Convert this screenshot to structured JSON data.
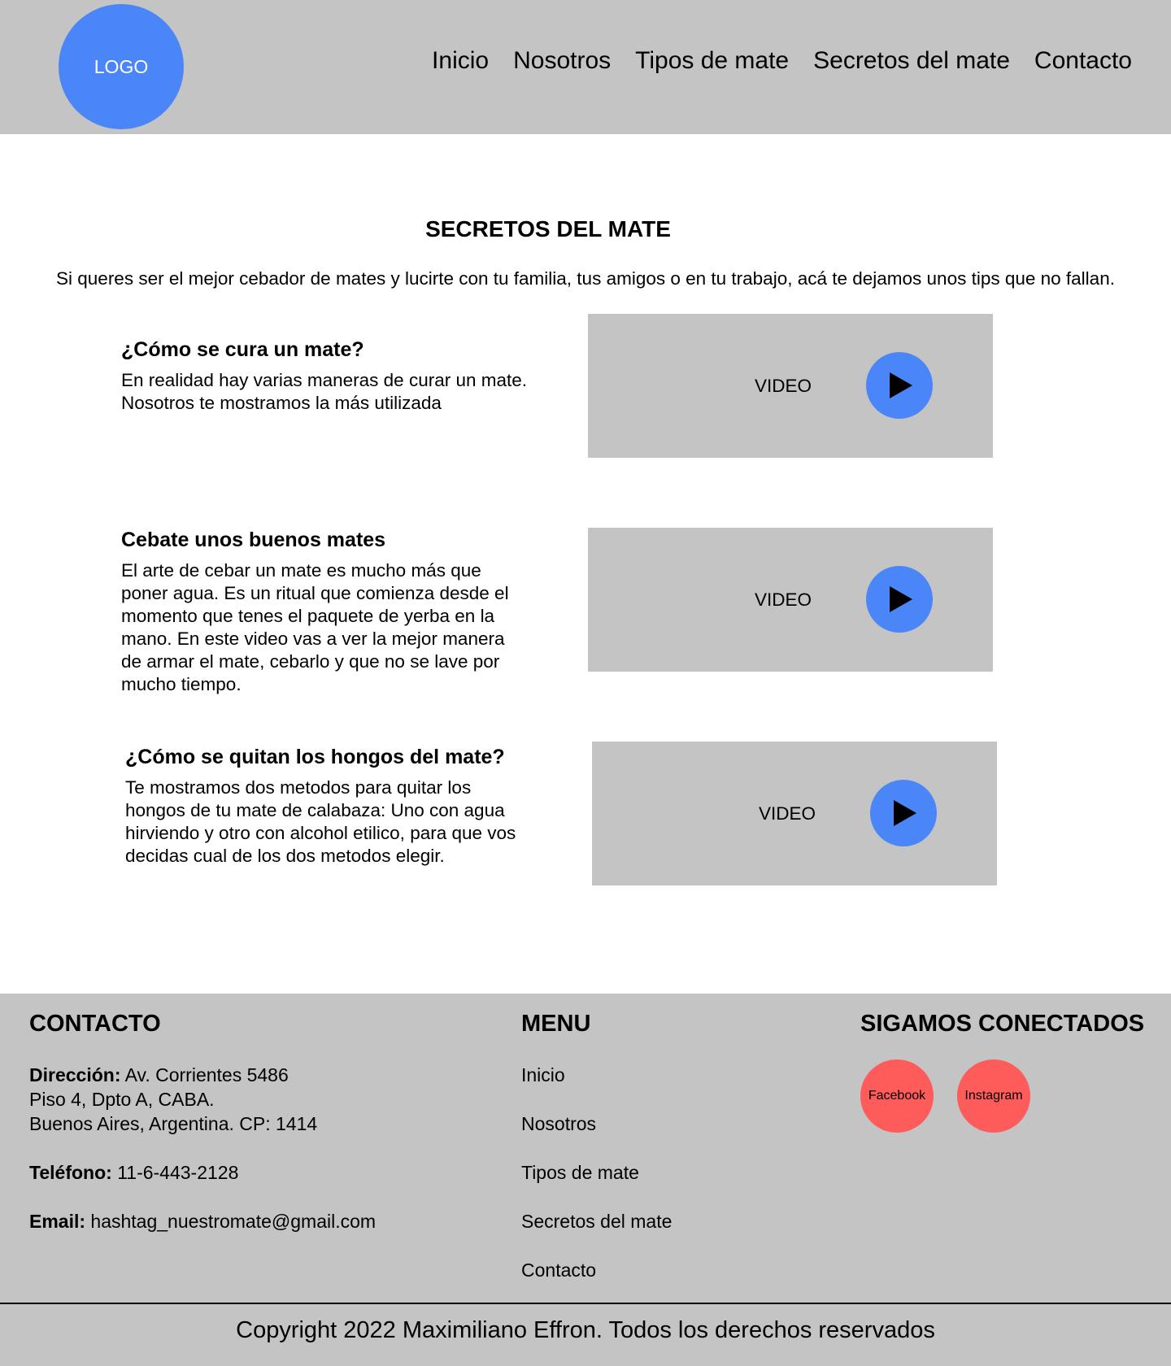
{
  "header": {
    "logo": "LOGO",
    "nav": [
      "Inicio",
      "Nosotros",
      "Tipos de mate",
      "Secretos del mate",
      "Contacto"
    ]
  },
  "main": {
    "title": "SECRETOS DEL MATE",
    "intro": "Si queres ser el mejor cebador de mates y lucirte con tu familia, tus amigos o en tu trabajo, acá te dejamos unos tips que no fallan.",
    "sections": [
      {
        "heading": "¿Cómo se cura un mate?",
        "body_lines": [
          "En realidad hay varias maneras de curar un mate.",
          "Nosotros te mostramos la más utilizada"
        ],
        "video_label": "VIDEO"
      },
      {
        "heading": "Cebate unos buenos mates",
        "body_lines": [
          "El arte de cebar un mate es mucho más que",
          "poner agua. Es un ritual que comienza desde el",
          "momento que tenes el paquete de yerba en la",
          "mano. En este video vas a ver la mejor manera",
          "de armar el mate, cebarlo y que no se lave por",
          "mucho tiempo."
        ],
        "video_label": "VIDEO"
      },
      {
        "heading": "¿Cómo se quitan los hongos del mate?",
        "body_lines": [
          "Te mostramos dos metodos para quitar los",
          "hongos de tu mate de calabaza: Uno con agua",
          "hirviendo y otro con alcohol etilico, para que vos",
          "decidas cual de los dos metodos elegir."
        ],
        "video_label": "VIDEO"
      }
    ]
  },
  "footer": {
    "contact": {
      "heading": "CONTACTO",
      "address_label": "Dirección:",
      "address_line1": "Av. Corrientes 5486",
      "address_line2": "Piso 4, Dpto A, CABA.",
      "address_line3": "Buenos Aires, Argentina. CP: 1414",
      "phone_label": "Teléfono:",
      "phone": "11-6-443-2128",
      "email_label": "Email:",
      "email": "hashtag_nuestromate@gmail.com"
    },
    "menu": {
      "heading": "MENU",
      "items": [
        "Inicio",
        "Nosotros",
        "Tipos de mate",
        "Secretos del mate",
        "Contacto"
      ]
    },
    "social": {
      "heading": "SIGAMOS CONECTADOS",
      "links": [
        "Facebook",
        "Instagram"
      ]
    },
    "copyright": "Copyright 2022 Maximiliano Effron. Todos los derechos reservados"
  },
  "colors": {
    "gray": "#c4c4c4",
    "blue": "#4a86f7",
    "red": "#fe5b5b"
  },
  "icons": [
    "play-icon"
  ]
}
